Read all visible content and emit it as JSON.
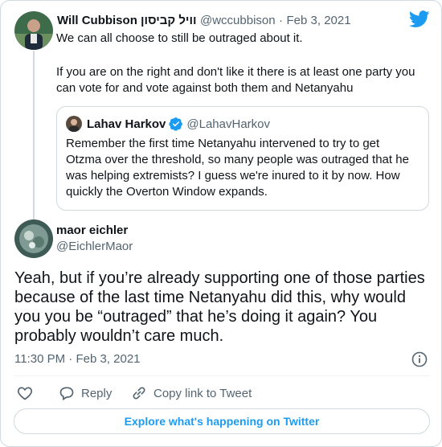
{
  "colors": {
    "brand": "#1d9bf0",
    "text": "#0f1419",
    "secondary": "#536471",
    "border": "#cfd9de"
  },
  "parent_tweet": {
    "display_name": "Will Cubbison וויל קביסון",
    "handle": "@wccubbison",
    "separator": "·",
    "date": "Feb 3, 2021",
    "paragraph1": "We can all choose to still be outraged about it.",
    "paragraph2_line1": "If you are on the right and don't like it there is at least one party you",
    "paragraph2_line2": "can vote for and vote against both them and Netanyahu"
  },
  "quoted_tweet": {
    "display_name": "Lahav Harkov",
    "verified_icon": "verified-badge-icon",
    "handle": "@LahavHarkov",
    "lines": [
      "Remember the first time Netanyahu intervened to try to get",
      "Otzma over the threshold, so many people was outraged that he",
      "was helping extremists? I guess we're inured to it by now. How",
      "quickly the Overton Window expands."
    ]
  },
  "main_tweet": {
    "display_name": "maor eichler",
    "handle": "@EichlerMaor",
    "lines": [
      "Yeah, but if you’re already supporting one of those parties",
      "because of the last time Netanyahu did this, why would",
      "you you be “outraged” that he’s doing it again? You",
      "probably wouldn’t care much."
    ],
    "time": "11:30 PM",
    "separator": "·",
    "date": "Feb 3, 2021"
  },
  "actions": {
    "like_icon": "heart-icon",
    "reply_icon": "reply-icon",
    "reply_label": "Reply",
    "copy_icon": "link-icon",
    "copy_label": "Copy link to Tweet",
    "info_icon": "info-icon"
  },
  "explore_label": "Explore what's happening on Twitter"
}
